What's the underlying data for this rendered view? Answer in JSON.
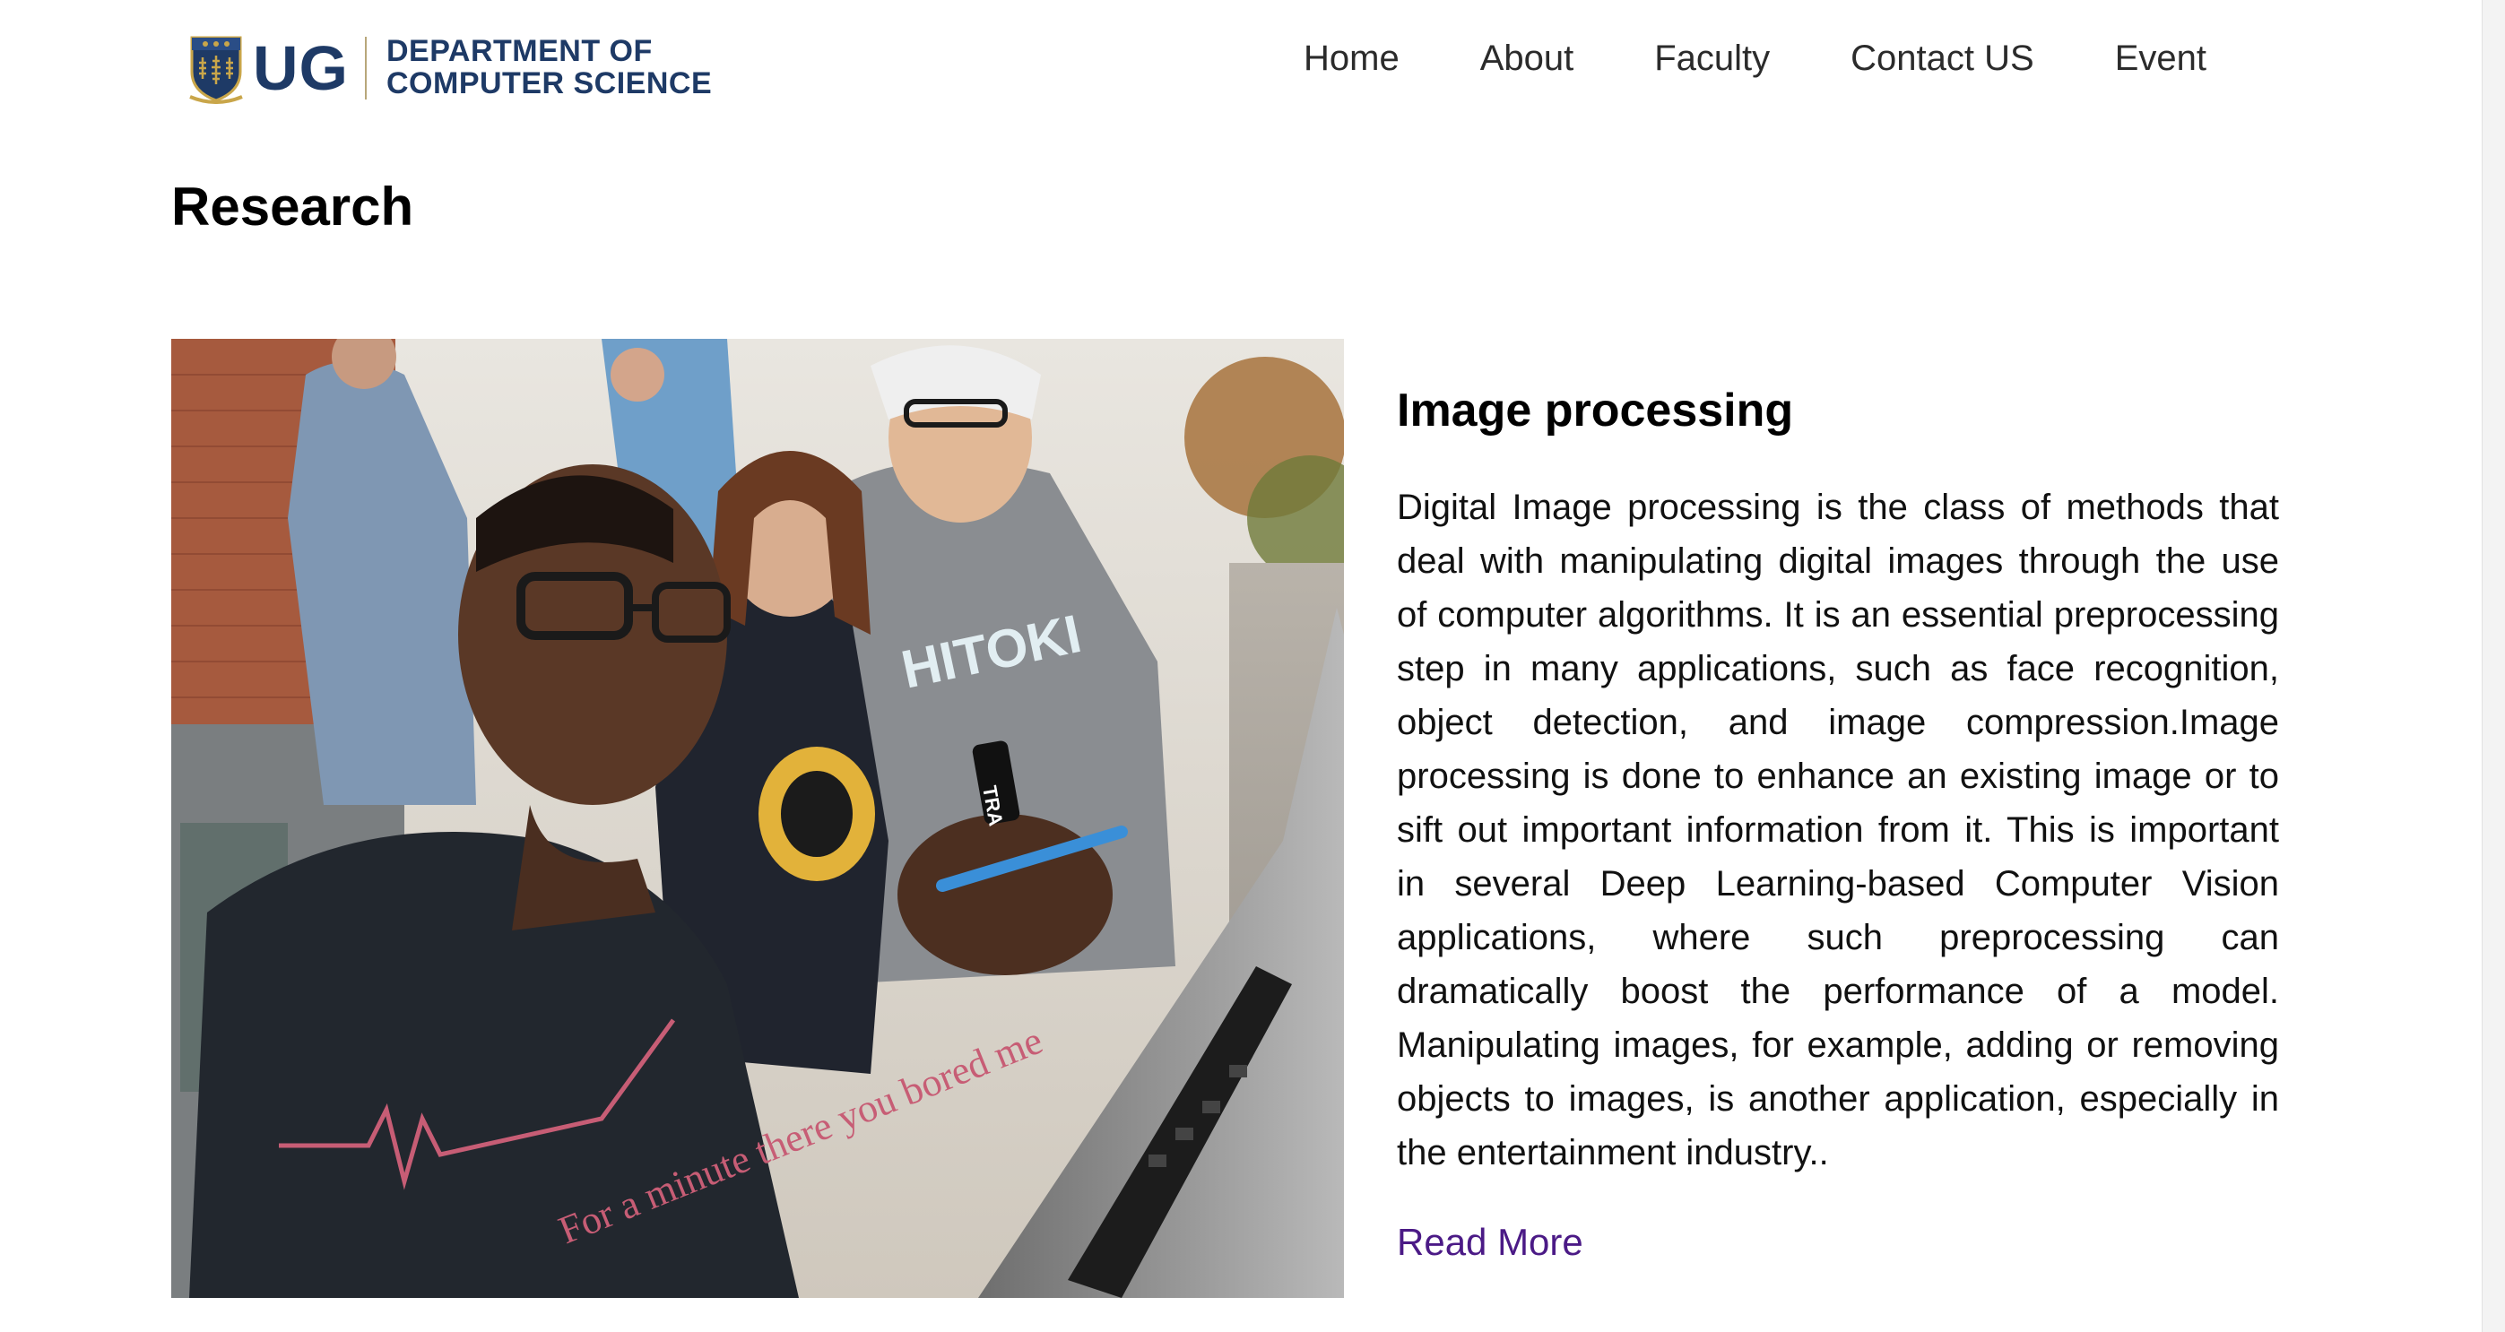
{
  "brand": {
    "logo_mark": "UG",
    "dept_line1": "DEPARTMENT OF",
    "dept_line2": "COMPUTER SCIENCE"
  },
  "nav": {
    "items": [
      {
        "label": "Home"
      },
      {
        "label": "About"
      },
      {
        "label": "Faculty"
      },
      {
        "label": "Contact US"
      },
      {
        "label": "Event"
      }
    ]
  },
  "page": {
    "title": "Research"
  },
  "research_card": {
    "title": "Image processing",
    "body": "Digital Image processing is the class of methods that deal with manipulating digital images through the use of computer algorithms. It is an essential preprocessing step in many applications, such as face recognition, object detection, and image compression.Image processing is done to enhance an existing image or to sift out important information from it. This is important in several Deep Learning-based Computer Vision applications, where such preprocessing can dramatically boost the performance of a model. Manipulating images, for example, adding or removing objects to images, is another application, especially in the entertainment industry..",
    "read_more": "Read More",
    "photo_shirt_text": "For a minute there you bored me",
    "photo_tshirt_text": "HITOKI",
    "photo_wristband_text": "TRA"
  },
  "colors": {
    "brand_navy": "#1e3a66",
    "link_purple": "#4b1a86"
  }
}
